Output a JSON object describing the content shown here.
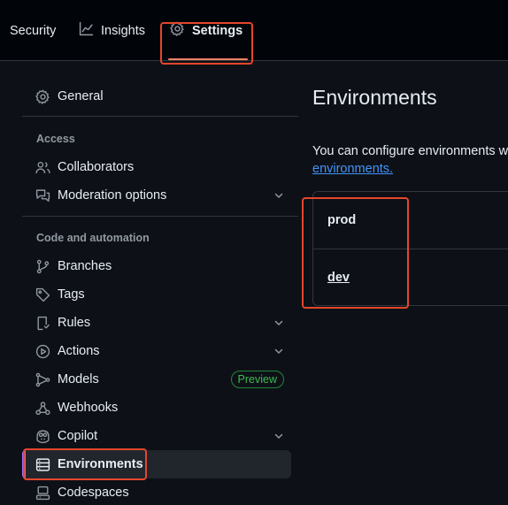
{
  "header": {
    "tabs": [
      {
        "label": "Security",
        "icon": "none"
      },
      {
        "label": "Insights",
        "icon": "graph-icon"
      },
      {
        "label": "Settings",
        "icon": "gear-icon",
        "selected": true
      }
    ]
  },
  "sidebar": {
    "general": "General",
    "sections": [
      {
        "heading": "Access",
        "items": [
          "Collaborators",
          "Moderation options"
        ]
      },
      {
        "heading": "Code and automation",
        "items": [
          "Branches",
          "Tags",
          "Rules",
          "Actions",
          "Models",
          "Webhooks",
          "Copilot",
          "Environments",
          "Codespaces"
        ]
      }
    ],
    "models_badge": "Preview",
    "active_item": "Environments"
  },
  "main": {
    "title": "Environments",
    "description": "You can configure environments w",
    "link_text": "environments.",
    "environments": [
      "prod",
      "dev"
    ]
  },
  "colors": {
    "background": "#0d1117",
    "topbar": "#010409",
    "accent_underline": "#f78166",
    "highlight": "#e5462c",
    "link": "#4493f8",
    "badge": "#3fb950",
    "active_bar": "#a371f7"
  }
}
